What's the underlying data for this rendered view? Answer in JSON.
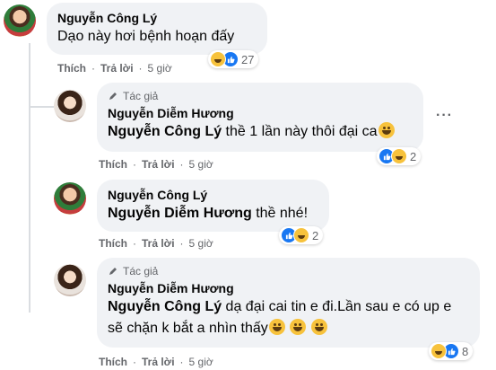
{
  "labels": {
    "like": "Thích",
    "reply": "Trả lời",
    "dot": "·",
    "author_badge": "Tác giả"
  },
  "comments": [
    {
      "author": "Nguyễn Công Lý",
      "text": "Dạo này hơi bệnh hoạn đấy",
      "time": "5 giờ",
      "reaction_count": "27"
    },
    {
      "author": "Nguyễn Diễm Hương",
      "mention": "Nguyễn Công Lý",
      "text": " thề 1 lần này thôi đại ca",
      "time": "5 giờ",
      "reaction_count": "2"
    },
    {
      "author": "Nguyễn Công Lý",
      "mention": "Nguyễn Diễm Hương",
      "text": " thề nhé!",
      "time": "5 giờ",
      "reaction_count": "2"
    },
    {
      "author": "Nguyễn Diễm Hương",
      "mention": "Nguyễn Công Lý",
      "text": " dạ đại cai tin e đi.Lần sau e có up e sẽ chặn k bắt a nhìn thấy",
      "time": "5 giờ",
      "reaction_count": "8"
    }
  ],
  "icons": {
    "like": "like-icon",
    "haha": "haha-icon",
    "more": "more-options-icon",
    "pen": "pen-icon"
  },
  "colors": {
    "bubble": "#f0f2f5",
    "like": "#1877f2",
    "haha": "#f7c23c",
    "meta": "#65676b"
  }
}
